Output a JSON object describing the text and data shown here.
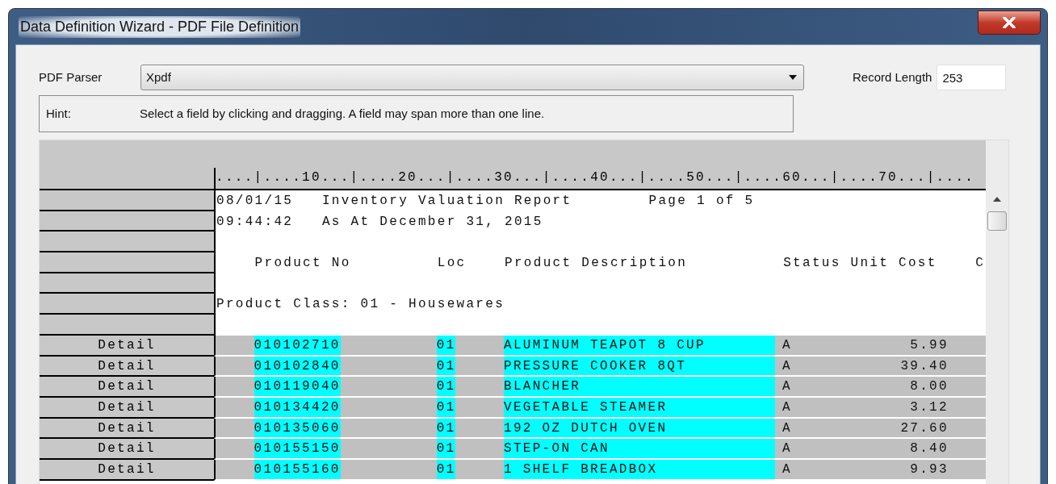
{
  "window": {
    "title": "Data Definition Wizard - PDF File Definition"
  },
  "parser": {
    "label": "PDF Parser",
    "value": "Xpdf"
  },
  "record_length": {
    "label": "Record Length",
    "value": "253"
  },
  "hint": {
    "label": "Hint:",
    "text": "Select a field by clicking and dragging. A field may span more than one line."
  },
  "ruler": "....|....10...|....20...|....30...|....40...|....50...|....60...|....70...|....",
  "detail_fields": [
    {
      "selected": true
    },
    {
      "selected": true
    },
    {
      "selected": true
    },
    {
      "selected": false
    },
    {
      "selected": false
    }
  ],
  "rows": [
    {
      "kind": "text",
      "text": "08/01/15   Inventory Valuation Report        Page 1 of 5"
    },
    {
      "kind": "text",
      "text": "09:44:42   As At December 31, 2015"
    },
    {
      "kind": "text"
    },
    {
      "kind": "text",
      "text": "    Product No         Loc    Product Description          Status Unit Cost    C"
    },
    {
      "kind": "text"
    },
    {
      "kind": "text",
      "text": "Product Class: 01 - Housewares"
    },
    {
      "kind": "text"
    },
    {
      "kind": "detail",
      "label": "Detail",
      "cells": [
        "010102710",
        "01",
        "ALUMINUM TEAPOT 8 CUP",
        "A",
        "5.99"
      ]
    },
    {
      "kind": "detail",
      "label": "Detail",
      "cells": [
        "010102840",
        "01",
        "PRESSURE COOKER 8QT",
        "A",
        "39.40"
      ]
    },
    {
      "kind": "detail",
      "label": "Detail",
      "cells": [
        "010119040",
        "01",
        "BLANCHER",
        "A",
        "8.00"
      ]
    },
    {
      "kind": "detail",
      "label": "Detail",
      "cells": [
        "010134420",
        "01",
        "VEGETABLE STEAMER",
        "A",
        "3.12"
      ]
    },
    {
      "kind": "detail",
      "label": "Detail",
      "cells": [
        "010135060",
        "01",
        "192 OZ DUTCH OVEN",
        "A",
        "27.60"
      ]
    },
    {
      "kind": "detail",
      "label": "Detail",
      "cells": [
        "010155150",
        "01",
        "STEP-ON CAN",
        "A",
        "8.40"
      ]
    },
    {
      "kind": "detail",
      "label": "Detail",
      "cells": [
        "010155160",
        "01",
        "1 SHELF BREADBOX",
        "A",
        "9.93"
      ]
    }
  ]
}
